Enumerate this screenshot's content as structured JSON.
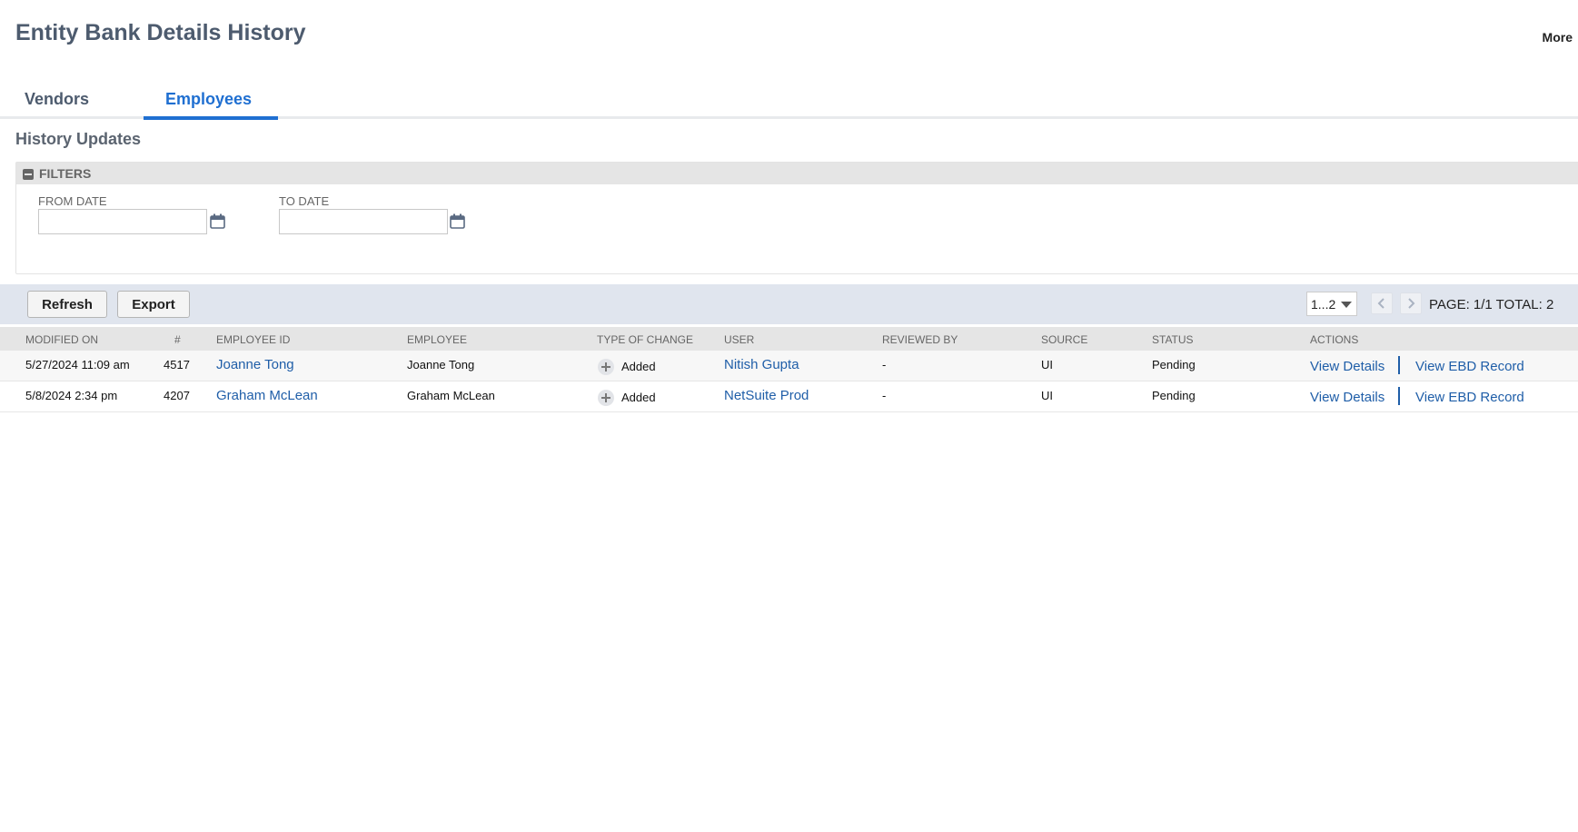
{
  "page": {
    "title": "Entity Bank Details History",
    "more_label": "More"
  },
  "tabs": [
    {
      "label": "Vendors",
      "active": false
    },
    {
      "label": "Employees",
      "active": true
    }
  ],
  "section": {
    "title": "History Updates"
  },
  "filters": {
    "label": "FILTERS",
    "from_date": {
      "label": "FROM DATE",
      "value": ""
    },
    "to_date": {
      "label": "TO DATE",
      "value": ""
    }
  },
  "toolbar": {
    "refresh_label": "Refresh",
    "export_label": "Export",
    "pager_select": "1...2",
    "page_info": "PAGE: 1/1  TOTAL: 2"
  },
  "table": {
    "headers": {
      "modified_on": "MODIFIED ON",
      "num": "#",
      "employee_id": "EMPLOYEE ID",
      "employee": "EMPLOYEE",
      "type_of_change": "TYPE OF CHANGE",
      "user": "USER",
      "reviewed_by": "REVIEWED BY",
      "source": "SOURCE",
      "status": "STATUS",
      "actions": "ACTIONS"
    },
    "rows": [
      {
        "modified_on": "5/27/2024 11:09 am",
        "num": "4517",
        "employee_id": "Joanne Tong",
        "employee": "Joanne Tong",
        "type_of_change": "Added",
        "user": "Nitish Gupta",
        "reviewed_by": "-",
        "source": "UI",
        "status": "Pending",
        "action_details": "View Details",
        "action_record": "View EBD Record"
      },
      {
        "modified_on": "5/8/2024 2:34 pm",
        "num": "4207",
        "employee_id": "Graham McLean",
        "employee": "Graham McLean",
        "type_of_change": "Added",
        "user": "NetSuite Prod",
        "reviewed_by": "-",
        "source": "UI",
        "status": "Pending",
        "action_details": "View Details",
        "action_record": "View EBD Record"
      }
    ]
  },
  "colors": {
    "accent": "#1f6fd1",
    "link": "#1f5ea8",
    "title": "#4d5b6e",
    "toolbar_bg": "#e0e5ee"
  },
  "icons": {
    "collapse": "collapse-minus-icon",
    "calendar": "calendar-icon",
    "change_added": "plus-circle-icon",
    "pager_caret": "caret-down-icon",
    "prev": "chevron-left-icon",
    "next": "chevron-right-icon"
  }
}
